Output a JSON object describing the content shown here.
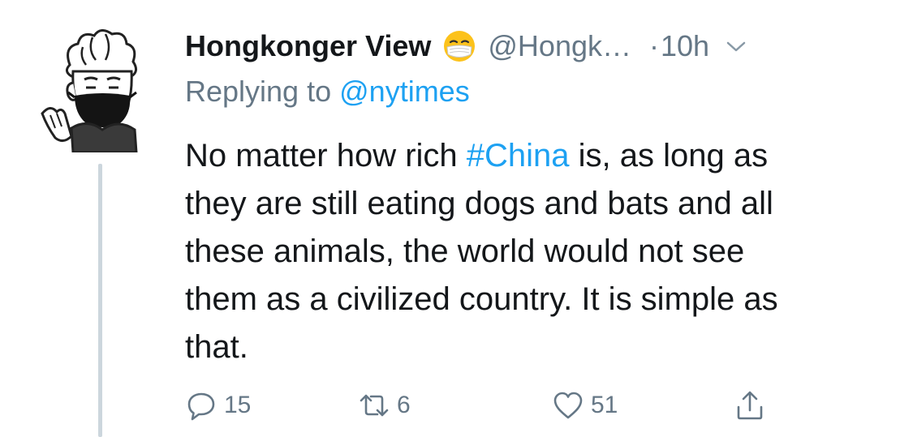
{
  "tweet": {
    "display_name": "Hongkonger View",
    "emoji_icon": "face-with-medical-mask-emoji",
    "handle": "@Hongk…",
    "separator": "·",
    "time": "10h",
    "reply_prefix": "Replying to",
    "reply_mention": "@nytimes",
    "body": {
      "line1_before": "No matter how rich ",
      "hashtag": "#China",
      "line1_after": " is, as long as",
      "line2": "they are still eating dogs and bats and all",
      "line3": "these animals, the world would not see",
      "line4": "them as a civilized country. It is simple as",
      "line5": "that."
    }
  },
  "actions": {
    "reply_count": "15",
    "retweet_count": "6",
    "like_count": "51"
  },
  "colors": {
    "text": "#14171a",
    "secondary": "#657786",
    "link": "#1da1f2",
    "thread_line": "#ccd6dd"
  }
}
